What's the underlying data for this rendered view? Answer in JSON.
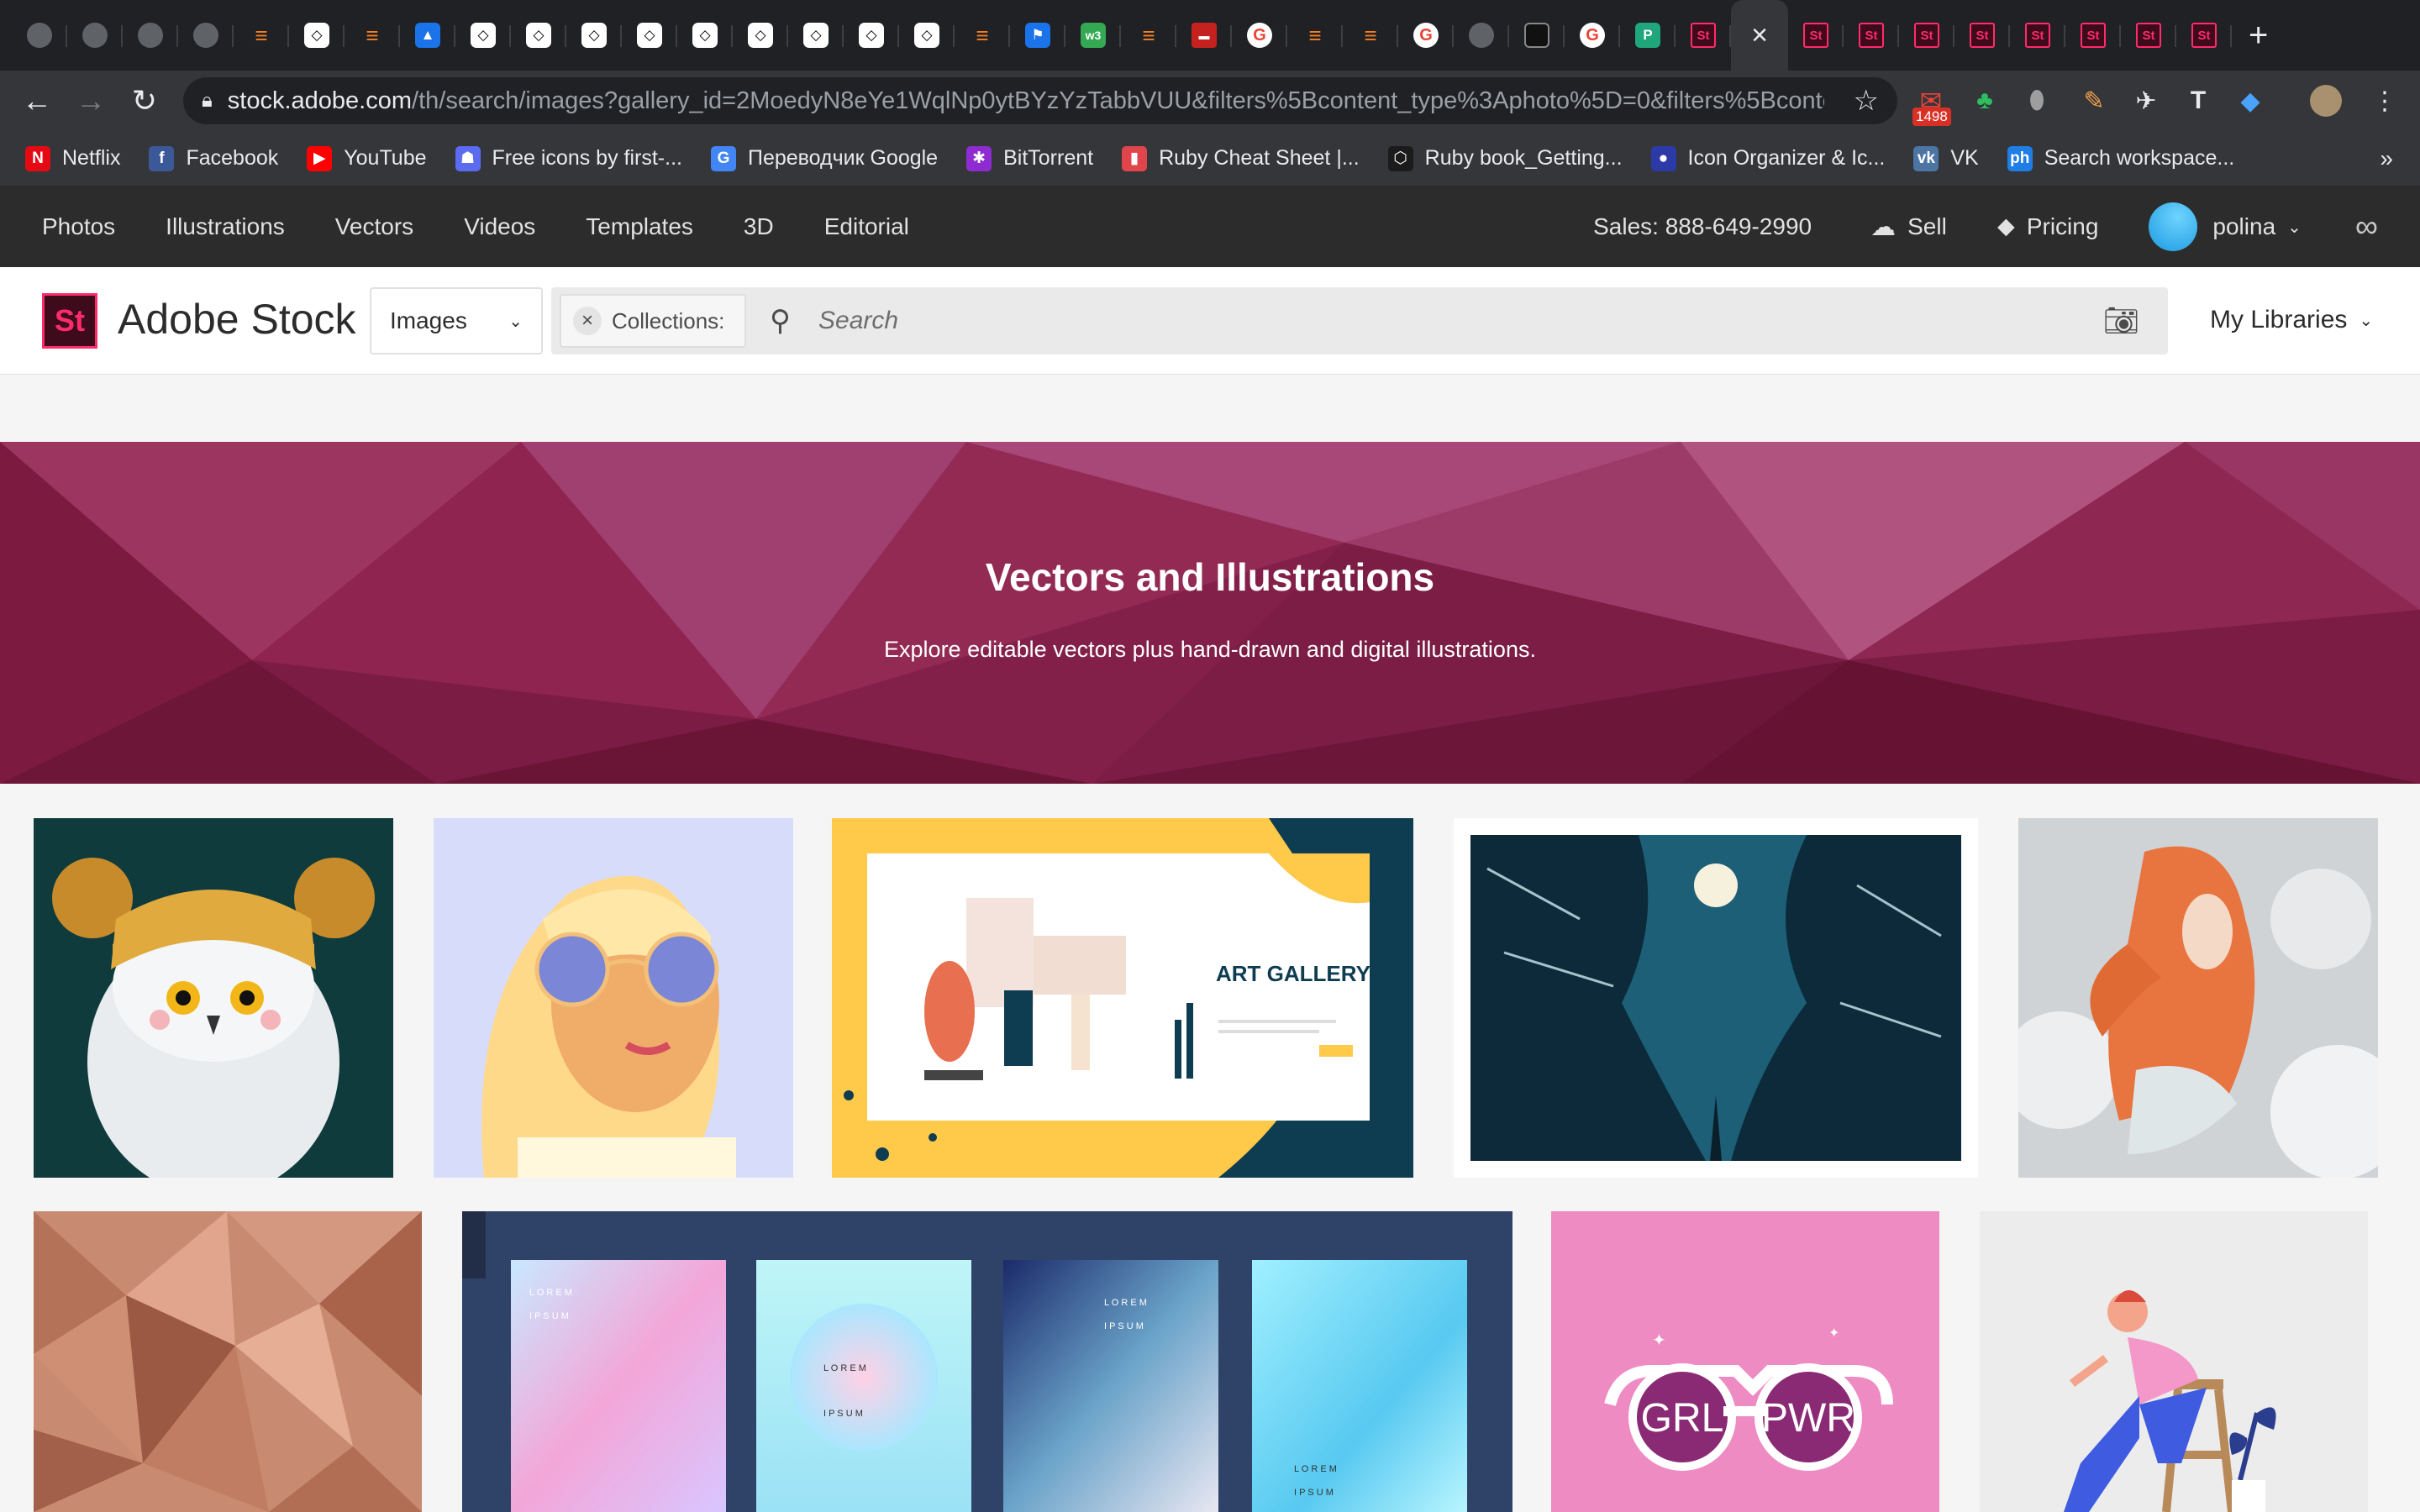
{
  "browser": {
    "tabs": [
      {
        "fav": "gh",
        "label": ""
      },
      {
        "fav": "gh",
        "label": ""
      },
      {
        "fav": "gh",
        "label": ""
      },
      {
        "fav": "gh",
        "label": ""
      },
      {
        "fav": "so",
        "label": "≡"
      },
      {
        "fav": "cp",
        "label": "◇"
      },
      {
        "fav": "so",
        "label": "≡"
      },
      {
        "fav": "flag",
        "label": "▲"
      },
      {
        "fav": "cp",
        "label": "◇"
      },
      {
        "fav": "cp",
        "label": "◇"
      },
      {
        "fav": "cp",
        "label": "◇"
      },
      {
        "fav": "cp",
        "label": "◇"
      },
      {
        "fav": "cp",
        "label": "◇"
      },
      {
        "fav": "cp",
        "label": "◇"
      },
      {
        "fav": "cp",
        "label": "◇"
      },
      {
        "fav": "cp",
        "label": "◇"
      },
      {
        "fav": "cp",
        "label": "◇"
      },
      {
        "fav": "so",
        "label": "≡"
      },
      {
        "fav": "flag",
        "label": "⚑"
      },
      {
        "fav": "w3",
        "label": "w3"
      },
      {
        "fav": "so",
        "label": "≡"
      },
      {
        "fav": "red",
        "label": "▬"
      },
      {
        "fav": "g",
        "label": "G"
      },
      {
        "fav": "so",
        "label": "≡"
      },
      {
        "fav": "so",
        "label": "≡"
      },
      {
        "fav": "g",
        "label": "G"
      },
      {
        "fav": "gh",
        "label": ""
      },
      {
        "fav": "dark",
        "label": ""
      },
      {
        "fav": "g",
        "label": "G"
      },
      {
        "fav": "grn",
        "label": "P"
      },
      {
        "fav": "st",
        "label": "St"
      }
    ],
    "active_tab_close": "×",
    "tabs_after": [
      {
        "fav": "st",
        "label": "St"
      },
      {
        "fav": "st",
        "label": "St"
      },
      {
        "fav": "st",
        "label": "St"
      },
      {
        "fav": "st",
        "label": "St"
      },
      {
        "fav": "st",
        "label": "St"
      },
      {
        "fav": "st",
        "label": "St"
      },
      {
        "fav": "st",
        "label": "St"
      },
      {
        "fav": "st",
        "label": "St"
      }
    ],
    "new_tab": "+",
    "url_host": "stock.adobe.com",
    "url_path": "/th/search/images?gallery_id=2MoedyN8eYe1WqlNp0ytBYzYzTabbVUU&filters%5Bcontent_type%3Aphoto%5D=0&filters%5Bconte...",
    "mail_badge": "1498",
    "bookmarks": [
      {
        "label": "Netflix",
        "icon": "N",
        "color": "#e50914"
      },
      {
        "label": "Facebook",
        "icon": "f",
        "color": "#3b5998"
      },
      {
        "label": "YouTube",
        "icon": "▶",
        "color": "#ff0000"
      },
      {
        "label": "Free icons by first-...",
        "icon": "☗",
        "color": "#5b6cf0"
      },
      {
        "label": "Переводчик Google",
        "icon": "G",
        "color": "#4285f4"
      },
      {
        "label": "BitTorrent",
        "icon": "✱",
        "color": "#8e2bd1"
      },
      {
        "label": "Ruby Cheat Sheet |...",
        "icon": "▮",
        "color": "#e0454b"
      },
      {
        "label": "Ruby book_Getting...",
        "icon": "⬡",
        "color": "#1b1b1b"
      },
      {
        "label": "Icon Organizer & Ic...",
        "icon": "●",
        "color": "#2b3aa6"
      },
      {
        "label": "VK",
        "icon": "vk",
        "color": "#4c75a3"
      },
      {
        "label": "Search workspace...",
        "icon": "ph",
        "color": "#1f7de6"
      }
    ],
    "bookmarks_more": "»"
  },
  "site_nav": {
    "links": [
      "Photos",
      "Illustrations",
      "Vectors",
      "Videos",
      "Templates",
      "3D",
      "Editorial"
    ],
    "sales": "Sales: 888-649-2990",
    "sell": "Sell",
    "pricing": "Pricing",
    "user": "polina"
  },
  "search": {
    "logo_mark": "St",
    "logo_text": "Adobe Stock",
    "type_select": "Images",
    "collections_label": "Collections:",
    "placeholder": "Search",
    "my_libraries": "My Libraries"
  },
  "hero": {
    "title": "Vectors and Illustrations",
    "subtitle": "Explore editable vectors plus hand-drawn and digital illustrations."
  },
  "gallery": {
    "items": [
      {
        "name": "owl-illustration",
        "bg": "#0f3b3d"
      },
      {
        "name": "woman-sunglasses-illustration",
        "bg": "#d8dcfb"
      },
      {
        "name": "art-gallery-landing-illustration",
        "bg": "#ffc94a",
        "text": "ART GALLERY"
      },
      {
        "name": "night-canyon-illustration",
        "bg": "#ffffff"
      },
      {
        "name": "woman-orange-scarf-illustration",
        "bg": "#cfd3d6"
      },
      {
        "name": "geometric-pattern-illustration",
        "bg": "#c98a72"
      },
      {
        "name": "gradient-posters-illustration",
        "bg": "#2f4267",
        "poster_text": "L O R E M",
        "poster_text2": "I P S U M"
      },
      {
        "name": "grl-pwr-glasses-illustration",
        "bg": "#ee8bc2",
        "left": "GRL",
        "right": "PWR"
      },
      {
        "name": "person-on-stool-illustration",
        "bg": "#ececec"
      }
    ]
  },
  "colors": {
    "accent": "#ff2b6b",
    "hero": "#8a1e48",
    "nav_bg": "#2c2c2c"
  }
}
